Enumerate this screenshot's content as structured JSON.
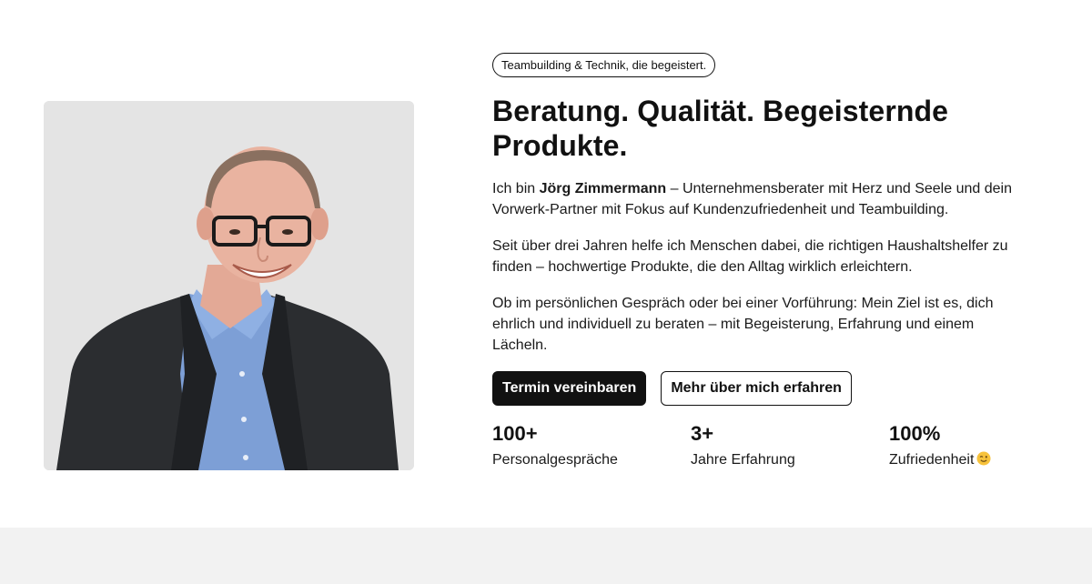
{
  "hero": {
    "tagline": "Teambuilding & Technik, die begeistert.",
    "headline": "Beratung. Qualität. Begeisternde Produkte.",
    "intro": {
      "prefix": "Ich bin ",
      "name": "Jörg Zimmermann",
      "suffix": " – Unternehmensberater mit Herz und Seele und dein Vorwerk-Partner mit Fokus auf Kundenzufriedenheit und Teambuilding."
    },
    "paragraph2": "Seit über drei Jahren helfe ich Menschen dabei, die richtigen Haushaltshelfer zu finden – hochwertige Produkte, die den Alltag wirklich erleichtern.",
    "paragraph3": "Ob im persönlichen Gespräch oder bei einer Vorführung: Mein Ziel ist es, dich ehrlich und individuell zu beraten – mit Begeisterung, Erfahrung und einem Lächeln.",
    "buttons": {
      "primary": "Termin vereinbaren",
      "secondary": "Mehr über mich erfahren"
    },
    "stats": [
      {
        "value": "100+",
        "label": "Personalgespräche"
      },
      {
        "value": "3+",
        "label": "Jahre Erfahrung"
      },
      {
        "value": "100%",
        "label": "Zufriedenheit",
        "icon": "winking-face-emoji-icon"
      }
    ],
    "photo_icon": "portrait-photo"
  },
  "colors": {
    "text": "#111111",
    "primary_button_bg": "#111111",
    "photo_bg": "#e4e4e4",
    "footer_band": "#f2f2f2"
  }
}
